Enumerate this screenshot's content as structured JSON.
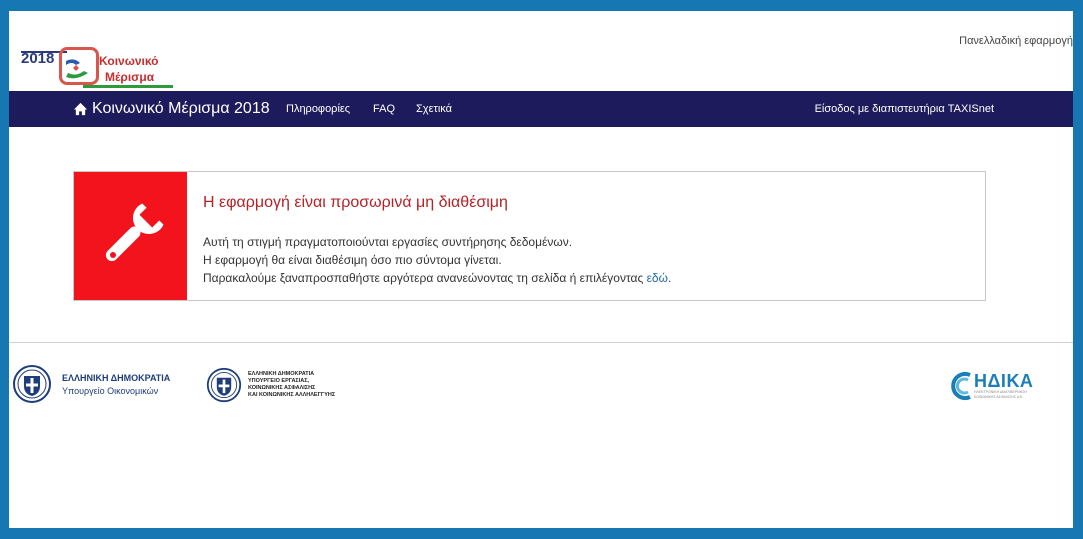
{
  "logo": {
    "year": "2018",
    "line1": "Κοινωνικό",
    "line2": "Μέρισμα"
  },
  "header": {
    "top_right": "Πανελλαδική εφαρμογή"
  },
  "navbar": {
    "brand": "Κοινωνικό Μέρισμα 2018",
    "links": [
      "Πληροφορίες",
      "FAQ",
      "Σχετικά"
    ],
    "login": "Είσοδος με διαπιστευτήρια TAXISnet"
  },
  "alert": {
    "title": "Η εφαρμογή είναι προσωρινά μη διαθέσιμη",
    "line1": "Αυτή τη στιγμή πραγματοποιούνται εργασίες συντήρησης δεδομένων.",
    "line2": "Η εφαρμογή θα είναι διαθέσιμη όσο πιο σύντομα γίνεται.",
    "line3": "Παρακαλούμε ξαναπροσπαθήστε αργότερα ανανεώνοντας τη σελίδα ή επιλέγοντας ",
    "link": "εδώ",
    "end": ".",
    "icon": "wrench-icon",
    "color": "#f3131d"
  },
  "footer": {
    "ministry1": {
      "line1": "ΕΛΛΗΝΙΚΗ ΔΗΜΟΚΡΑΤΙΑ",
      "line2": "Υπουργείο Οικονομικών"
    },
    "ministry2": {
      "line1": "ΕΛΛΗΝΙΚΗ ΔΗΜΟΚΡΑΤΙΑ",
      "line2": "ΥΠΟΥΡΓΕΙΟ ΕΡΓΑΣΙΑΣ,",
      "line3": "ΚΟΙΝΩΝΙΚΗΣ ΑΣΦΑΛΙΣΗΣ",
      "line4": "ΚΑΙ ΚΟΙΝΩΝΙΚΗΣ ΑΛΛΗΛΕΓΓΥΗΣ"
    },
    "idika": {
      "name": "ΗΔΙΚΑ",
      "sub1": "ΗΛΕΚΤΡΟΝΙΚΗ ΔΙΑΚΥΒΕΡΝΗΣΗ",
      "sub2": "ΚΟΙΝΩΝΙΚΗΣ ΑΣΦΑΛΙΣΗΣ Α.Ε."
    }
  },
  "colors": {
    "navbar": "#1e1b5c",
    "frame": "#1677b3",
    "alert_title": "#b52226",
    "link": "#1f6aa5"
  }
}
